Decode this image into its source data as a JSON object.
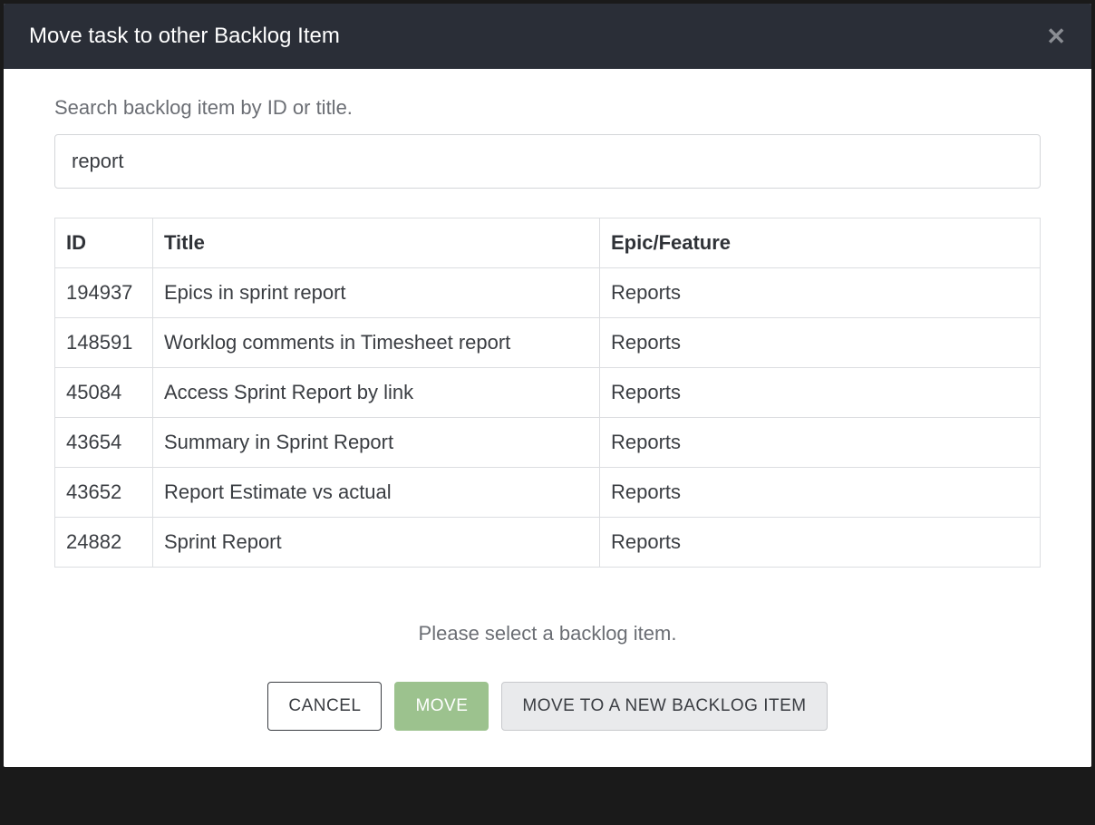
{
  "modal": {
    "title": "Move task to other Backlog Item",
    "close_symbol": "✕"
  },
  "search": {
    "label": "Search backlog item by ID or title.",
    "value": "report"
  },
  "table": {
    "headers": {
      "id": "ID",
      "title": "Title",
      "epic": "Epic/Feature"
    },
    "rows": [
      {
        "id": "194937",
        "title": "Epics in sprint report",
        "epic": "Reports"
      },
      {
        "id": "148591",
        "title": "Worklog comments in Timesheet report",
        "epic": "Reports"
      },
      {
        "id": "45084",
        "title": "Access Sprint Report by link",
        "epic": "Reports"
      },
      {
        "id": "43654",
        "title": "Summary in Sprint Report",
        "epic": "Reports"
      },
      {
        "id": "43652",
        "title": "Report Estimate vs actual",
        "epic": "Reports"
      },
      {
        "id": "24882",
        "title": "Sprint Report",
        "epic": "Reports"
      }
    ]
  },
  "hint": "Please select a backlog item.",
  "buttons": {
    "cancel": "CANCEL",
    "move": "MOVE",
    "new_backlog": "MOVE TO A NEW BACKLOG ITEM"
  }
}
